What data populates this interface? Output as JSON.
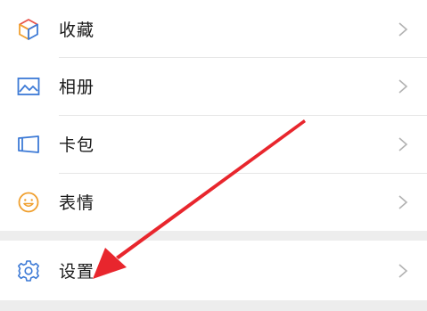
{
  "menu": {
    "items": [
      {
        "label": "收藏",
        "icon": "favorites-cube-icon"
      },
      {
        "label": "相册",
        "icon": "album-picture-icon"
      },
      {
        "label": "卡包",
        "icon": "card-wallet-icon"
      },
      {
        "label": "表情",
        "icon": "sticker-smiley-icon"
      }
    ],
    "settings": {
      "label": "设置",
      "icon": "gear-icon"
    }
  },
  "colors": {
    "icon_blue": "#3d7ad6",
    "icon_orange": "#f0a030",
    "icon_red": "#e8534a",
    "icon_green": "#3fae63",
    "arrow": "#e8262d",
    "chevron": "#b2b2b2"
  }
}
